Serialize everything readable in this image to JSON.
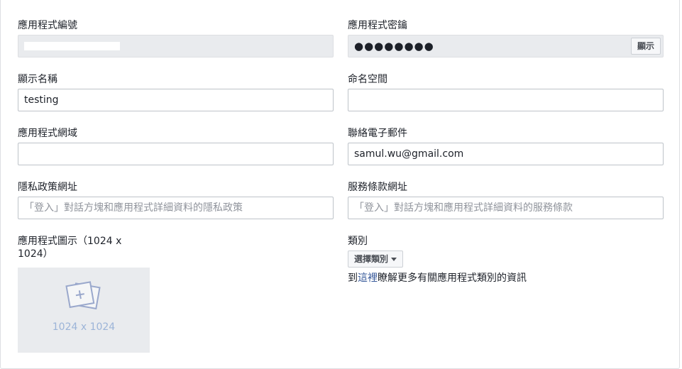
{
  "fields": {
    "app_id": {
      "label": "應用程式編號",
      "value": ""
    },
    "app_secret": {
      "label": "應用程式密鑰",
      "masked_value": "●●●●●●●●",
      "show_button": "顯示"
    },
    "display_name": {
      "label": "顯示名稱",
      "value": "testing"
    },
    "namespace": {
      "label": "命名空間",
      "value": ""
    },
    "app_domains": {
      "label": "應用程式網域",
      "value": ""
    },
    "contact_email": {
      "label": "聯絡電子郵件",
      "value": "samul.wu@gmail.com"
    },
    "privacy_url": {
      "label": "隱私政策網址",
      "placeholder": "「登入」對話方塊和應用程式詳細資料的隱私政策"
    },
    "tos_url": {
      "label": "服務條款網址",
      "placeholder": "「登入」對話方塊和應用程式詳細資料的服務條款"
    },
    "app_icon": {
      "label_line1": "應用程式圖示（1024 x",
      "label_line2": "1024）",
      "caption": "1024 x 1024"
    },
    "category": {
      "label": "類別",
      "select_label": "選擇類別",
      "help_prefix": "到",
      "help_link": "這裡",
      "help_suffix": "瞭解更多有關應用程式類別的資訊"
    }
  },
  "colors": {
    "readonly_bg": "#e9ebee",
    "border": "#bec3c9",
    "link": "#365899",
    "placeholder": "#90949c",
    "icon_caption": "#9cb4d8"
  }
}
